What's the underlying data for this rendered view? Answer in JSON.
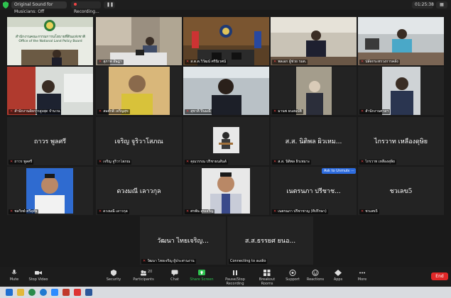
{
  "topbar": {
    "audio_label": "Original Sound for Musicians: Off",
    "recording_label": "Recording...",
    "clock": "01:25:38"
  },
  "tiles": [
    {
      "id": "t1",
      "label": "สำนักงานคณะกรรมการนโยบายที่ดินแห่งชาติ",
      "sign_th": "สำนักงานคณะกรรมการนโยบายที่ดินแห่งชาติ",
      "sign_en": "Office of the National Land Policy Board"
    },
    {
      "id": "t2",
      "label": "สุภาพ อัษฎา"
    },
    {
      "id": "t3",
      "label": "ส.ต.ต.วิวัฒน์ ศรีนิเวศน์"
    },
    {
      "id": "t4",
      "label": "พลเอก ผู้ช่วย รมต."
    },
    {
      "id": "t5",
      "label": "ปลัดกระทรวงการคลัง"
    },
    {
      "id": "t6",
      "label": "สำนักงานอัยการสูงสุด จำนวน"
    },
    {
      "id": "t7",
      "label": "สมศักดิ์ เจริญสุข"
    },
    {
      "id": "t8",
      "label": "สุชาติ ปิ่นมณี"
    },
    {
      "id": "t9",
      "label": "มานพ ธนสมบัติ"
    },
    {
      "id": "t10",
      "label": "สำนักงานศาลฯ"
    },
    {
      "id": "t11",
      "name": "ถาวร พูลศรี",
      "label": "ถาวร พูลศรี"
    },
    {
      "id": "t12",
      "name": "เจริญ จูริวาโสภณ",
      "label": "เจริญ จูริวาโสภณ"
    },
    {
      "id": "t13",
      "label": "คุณวรรณ ปริชาธนสันต์"
    },
    {
      "id": "t14",
      "name": "ส.ส. นิติพล ผิวเหม...",
      "label": "ส.ส. นิติพล ผิวเหมาะ"
    },
    {
      "id": "t15",
      "name": "ไกรวาท เหลืองดุษิย",
      "label": "ไกรวาท เหลืองดุษิย"
    },
    {
      "id": "t16",
      "label": "ชลวิทย์ ศรีอุทัย"
    },
    {
      "id": "t17",
      "name": "ดวงมณี เลาวกุล",
      "label": "ดวงมณี เลาวกุล"
    },
    {
      "id": "t18",
      "label": "ศรพัน สุขเจริญ"
    },
    {
      "id": "t19",
      "name": "เนตรนภา ปรีชาช...",
      "label": "เนตรนภา ปรีชาชาญ (ที่ปรึกษา)"
    },
    {
      "id": "t20",
      "name": "ชวเลข5",
      "label": "ชวเลข5"
    },
    {
      "id": "t21",
      "name": "วัฒนา ไทยเจริญ...",
      "label": "วัฒนา ไทยเจริญ ผู้ประสานงาน"
    },
    {
      "id": "t22",
      "name": "ส.ส.ธรรยศ ยนอ...",
      "label": "Connecting to audio"
    }
  ],
  "unmute_label": "Ask to Unmute",
  "toolbar": {
    "mute": "Mute",
    "stop_video": "Stop Video",
    "security": "Security",
    "participants": "Participants",
    "participants_count": "20",
    "chat": "Chat",
    "share": "Share Screen",
    "pause_recording": "Pause/Stop Recording",
    "breakout": "Breakout Rooms",
    "support": "Support",
    "reactions": "Reactions",
    "apps": "Apps",
    "more": "More",
    "end": "End"
  },
  "colors": {
    "active_speaker": "#d6d12c",
    "share_green": "#2ec24f",
    "end_red": "#e02828",
    "unmute_blue": "#2d6cdf"
  }
}
